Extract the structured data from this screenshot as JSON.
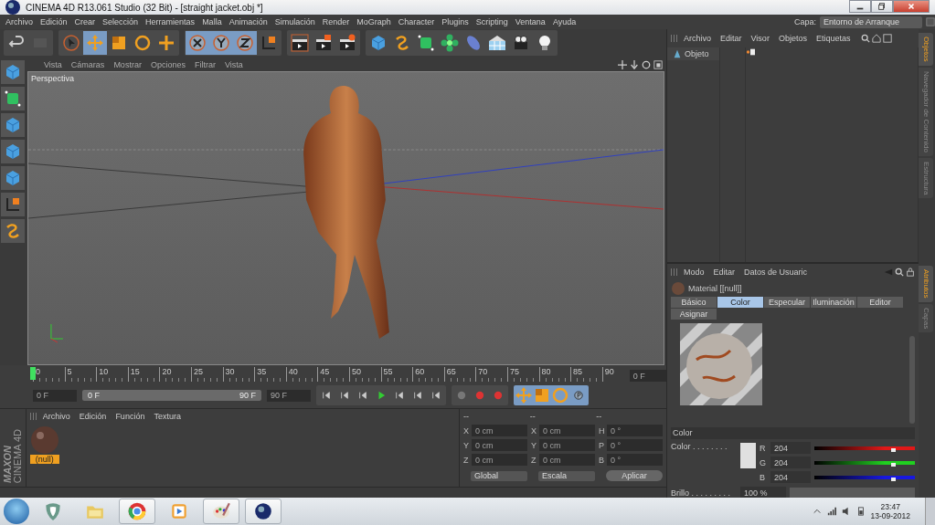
{
  "window": {
    "title": "CINEMA 4D R13.061 Studio (32 Bit) - [straight jacket.obj *]"
  },
  "menu_bar": [
    "Archivo",
    "Edición",
    "Crear",
    "Selección",
    "Herramientas",
    "Malla",
    "Animación",
    "Simulación",
    "Render",
    "MoGraph",
    "Character",
    "Plugins",
    "Scripting",
    "Ventana",
    "Ayuda"
  ],
  "layer": {
    "label": "Capa:",
    "value": "Entorno de Arranque"
  },
  "toolbar": [
    {
      "kind": "undo",
      "selected": false
    },
    {
      "kind": "redo",
      "selected": false
    },
    {
      "kind": "cursor",
      "selected": false
    },
    {
      "kind": "move",
      "selected": true
    },
    {
      "kind": "scale",
      "selected": false
    },
    {
      "kind": "rotate",
      "selected": false
    },
    {
      "kind": "plus",
      "selected": false
    },
    {
      "kind": "x-axis",
      "selected": true
    },
    {
      "kind": "y-axis",
      "selected": true
    },
    {
      "kind": "z-axis",
      "selected": true
    },
    {
      "kind": "axes",
      "selected": false
    },
    {
      "kind": "clapper",
      "selected": false
    },
    {
      "kind": "clapper-picture",
      "selected": false
    },
    {
      "kind": "clapper-gear",
      "selected": false
    },
    {
      "kind": "cube",
      "selected": false
    },
    {
      "kind": "spline",
      "selected": false
    },
    {
      "kind": "nurbs-cube",
      "selected": false
    },
    {
      "kind": "flower",
      "selected": false
    },
    {
      "kind": "capsule",
      "selected": false
    },
    {
      "kind": "floor",
      "selected": false
    },
    {
      "kind": "camera",
      "selected": false
    },
    {
      "kind": "lightbulb",
      "selected": false
    }
  ],
  "viewport": {
    "menu": [
      "Vista",
      "Cámaras",
      "Mostrar",
      "Opciones",
      "Filtrar",
      "Vista"
    ],
    "camera": "Perspectiva"
  },
  "timeline": {
    "ticks": [
      "0",
      "5",
      "10",
      "15",
      "20",
      "25",
      "30",
      "35",
      "40",
      "45",
      "50",
      "55",
      "60",
      "65",
      "70",
      "75",
      "80",
      "85",
      "90"
    ],
    "current_frame": "0 F",
    "start": "0 F",
    "range": {
      "start": "0 F",
      "end": "90 F",
      "level": 1
    },
    "end": "90 F"
  },
  "material_manager": {
    "brand": "MAXON",
    "product": "CINEMA 4D",
    "menu": [
      "Archivo",
      "Edición",
      "Función",
      "Textura"
    ],
    "materials": [
      {
        "name": "(null)",
        "selected": true
      }
    ]
  },
  "coordinates": {
    "headers": [
      "--",
      "--",
      "--"
    ],
    "rows": [
      [
        {
          "axis": "X",
          "value": "0 cm"
        },
        {
          "axis": "X",
          "value": "0 cm"
        },
        {
          "axis": "H",
          "value": "0 °"
        }
      ],
      [
        {
          "axis": "Y",
          "value": "0 cm"
        },
        {
          "axis": "Y",
          "value": "0 cm"
        },
        {
          "axis": "P",
          "value": "0 °"
        }
      ],
      [
        {
          "axis": "Z",
          "value": "0 cm"
        },
        {
          "axis": "Z",
          "value": "0 cm"
        },
        {
          "axis": "B",
          "value": "0 °"
        }
      ]
    ],
    "dropdowns": [
      "Global",
      "Escala"
    ],
    "apply": "Aplicar"
  },
  "object_manager": {
    "menu": [
      "Archivo",
      "Editar",
      "Visor",
      "Objetos",
      "Etiquetas"
    ],
    "objects": [
      {
        "name": "Objeto"
      }
    ]
  },
  "attributes": {
    "menu": [
      "Modo",
      "Editar",
      "Datos de Usuaric"
    ],
    "title": "Material [[null]]",
    "tabs": [
      {
        "label": "Básico",
        "selected": false
      },
      {
        "label": "Color",
        "selected": true
      },
      {
        "label": "Especular",
        "selected": false
      },
      {
        "label": "Iluminación",
        "selected": false
      },
      {
        "label": "Editor",
        "selected": false
      },
      {
        "label": "Asignar",
        "selected": false
      }
    ],
    "section": "Color",
    "color": {
      "label": "Color . . . . . . . .",
      "channels": [
        {
          "name": "R",
          "value": "204",
          "level": 0.78,
          "color": "#e01818"
        },
        {
          "name": "G",
          "value": "204",
          "level": 0.78,
          "color": "#20d020"
        },
        {
          "name": "B",
          "value": "204",
          "level": 0.78,
          "color": "#1818e0"
        }
      ]
    },
    "brightness": {
      "label": "Brillo . . . . . . . . .",
      "value": "100 %"
    }
  },
  "side_tabs_top": [
    {
      "label": "Objetos",
      "selected": true
    },
    {
      "label": "Navegador de Contenido",
      "selected": false
    },
    {
      "label": "Estructura",
      "selected": false
    }
  ],
  "side_tabs_bottom": [
    {
      "label": "Atributos",
      "selected": true
    },
    {
      "label": "Capas",
      "selected": false
    }
  ],
  "taskbar": {
    "apps": [
      {
        "kind": "shield",
        "running": false
      },
      {
        "kind": "folder",
        "running": false
      },
      {
        "kind": "browser",
        "running": true
      },
      {
        "kind": "media-player",
        "running": false
      },
      {
        "kind": "palette",
        "running": true
      },
      {
        "kind": "sphere-logo",
        "running": true
      }
    ],
    "time": "23:47",
    "date": "13-09-2012"
  }
}
